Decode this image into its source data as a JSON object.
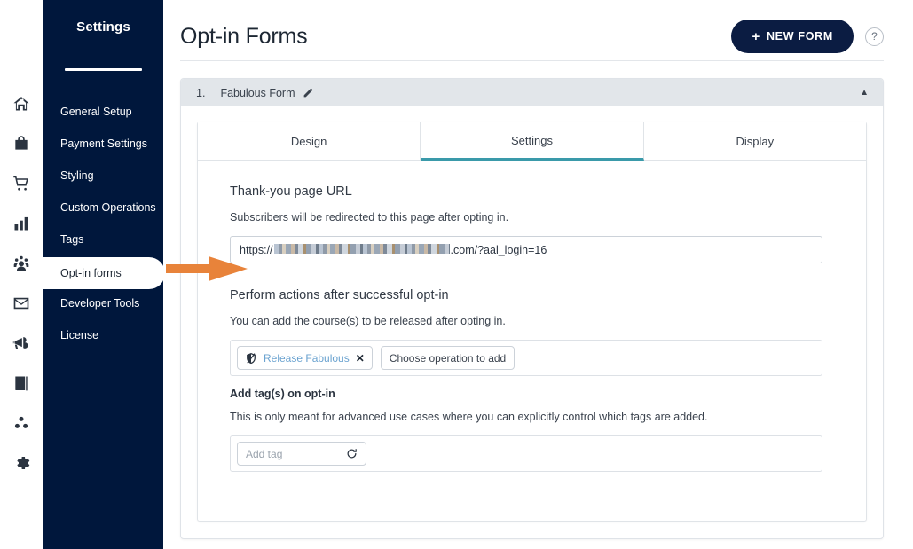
{
  "icon_rail": {
    "items": [
      {
        "icon": "home-icon"
      },
      {
        "icon": "bag-icon"
      },
      {
        "icon": "cart-icon"
      },
      {
        "icon": "bar-chart-icon"
      },
      {
        "icon": "users-icon"
      },
      {
        "icon": "envelope-icon"
      },
      {
        "icon": "megaphone-icon"
      },
      {
        "icon": "book-icon"
      },
      {
        "icon": "dots-network-icon"
      },
      {
        "icon": "gear-icon"
      }
    ]
  },
  "sidebar": {
    "title": "Settings",
    "items": [
      {
        "label": "General Setup",
        "active": false
      },
      {
        "label": "Payment Settings",
        "active": false
      },
      {
        "label": "Styling",
        "active": false
      },
      {
        "label": "Custom Operations",
        "active": false
      },
      {
        "label": "Tags",
        "active": false
      },
      {
        "label": "Opt-in forms",
        "active": true
      },
      {
        "label": "Developer Tools",
        "active": false
      },
      {
        "label": "License",
        "active": false
      }
    ],
    "bg_color": "#00173c"
  },
  "header": {
    "title": "Opt-in Forms",
    "new_form_button": "NEW FORM",
    "new_form_plus": "+",
    "help_label": "?",
    "button_color": "#0b1c42"
  },
  "form_card": {
    "number": "1.",
    "name": "Fabulous Form",
    "edit_icon": "pencil-icon",
    "collapse_icon": "triangle-up-icon",
    "header_bg": "#e2e6ea"
  },
  "tabs": [
    {
      "label": "Design",
      "active": false
    },
    {
      "label": "Settings",
      "active": true
    },
    {
      "label": "Display",
      "active": false
    }
  ],
  "tab_accent_color": "#3a9aaa",
  "settings": {
    "thankyou": {
      "title": "Thank-you page URL",
      "description": "Subscribers will be redirected to this page after opting in.",
      "url_prefix": "https://",
      "url_redacted": true,
      "url_suffix": ".com/?aal_login=16"
    },
    "actions": {
      "title": "Perform actions after successful opt-in",
      "description": "You can add the course(s) to be released after opting in.",
      "chips": [
        {
          "icon": "shield-slash-icon",
          "label": "Release Fabulous",
          "remove": "✕"
        }
      ],
      "placeholder": "Choose operation to add"
    },
    "tags": {
      "title": "Add tag(s) on opt-in",
      "description": "This is only meant for advanced use cases where you can explicitly control which tags are added.",
      "input_placeholder": "Add tag",
      "refresh_icon": "refresh-icon"
    }
  },
  "annotation": {
    "arrow": "orange-right-arrow",
    "color": "#e8833a"
  }
}
